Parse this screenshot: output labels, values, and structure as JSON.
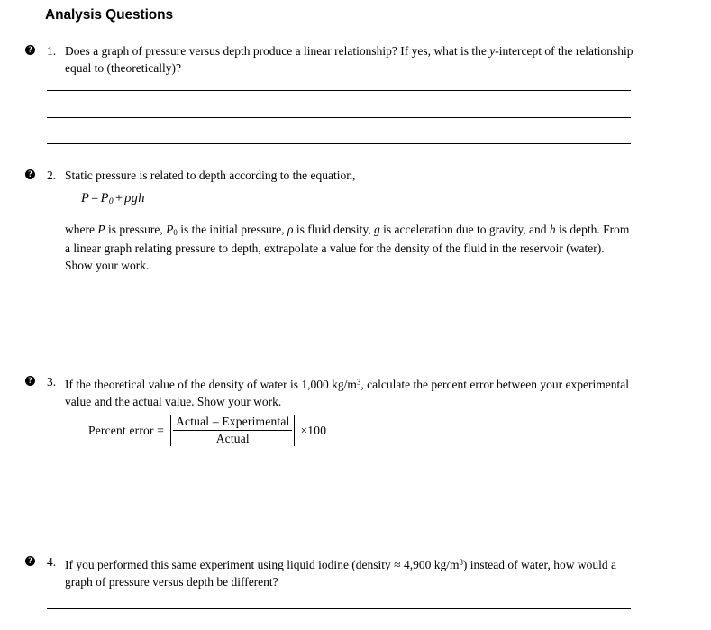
{
  "document": {
    "section_heading": "Analysis Questions",
    "marker_icon": "question-mark-circle-icon",
    "marker_glyph": "?"
  },
  "questions": [
    {
      "number": "1.",
      "text_line_1": "Does a graph of pressure versus depth produce a linear relationship? If yes, what is the",
      "text_line_2_prefix": "y",
      "text_line_2_rest": "-intercept of the relationship equal to (theoretically)?",
      "answer_lines": 3
    },
    {
      "number": "2.",
      "text_line_1": "Static pressure is related to depth according to the equation,",
      "equation": {
        "lhs": "P",
        "equals": "=",
        "rhs_symbol": "P",
        "rhs_subscript": "0",
        "plus": "+",
        "term": "ρgh",
        "full": "P = P0 + ρgh"
      },
      "paragraph_line_1": "where P is pressure, P0 is the initial pressure, ρ is fluid density, g is acceleration due to gravity,",
      "paragraph_line_2": "and h is depth. From a linear graph relating pressure to depth, extrapolate a value for the",
      "paragraph_line_3": "density of the fluid in the reservoir (water). Show your work.",
      "paragraph_parts": {
        "p1a": "where ",
        "p1b": "P",
        "p1c": " is pressure, ",
        "p1d": "P",
        "p1e": "0",
        "p1f": " is the initial pressure, ",
        "p1g": "ρ",
        "p1h": " is fluid density, ",
        "p1i": "g",
        "p1j": " is acceleration due to gravity, and ",
        "p1k": "h",
        "p1l": " is depth. From a linear graph relating pressure to depth, extrapolate a value for the density of the fluid in the reservoir (water). Show your work."
      },
      "answer_lines": 0
    },
    {
      "number": "3.",
      "text_part_a": "If the theoretical value of the density of water is 1,000 kg/m",
      "text_superscript": "3",
      "text_part_b": ", calculate the percent error between your experimental value and the actual value. Show your work.",
      "formula": {
        "label": "Percent error  =",
        "numerator": "Actual – Experimental",
        "denominator": "Actual",
        "multiplier": "×100",
        "full": "Percent error = |Actual – Experimental| / Actual × 100"
      },
      "answer_lines": 0
    },
    {
      "number": "4.",
      "text_part_a": "If you performed this same experiment using liquid iodine (density ≈ 4,900 kg/m",
      "text_superscript": "3",
      "text_part_b": ") instead of water, how would a graph of pressure versus depth be different?",
      "answer_lines": 1
    }
  ],
  "colors": {
    "background": "#ffffff",
    "text": "#000000",
    "rule": "#000000"
  }
}
